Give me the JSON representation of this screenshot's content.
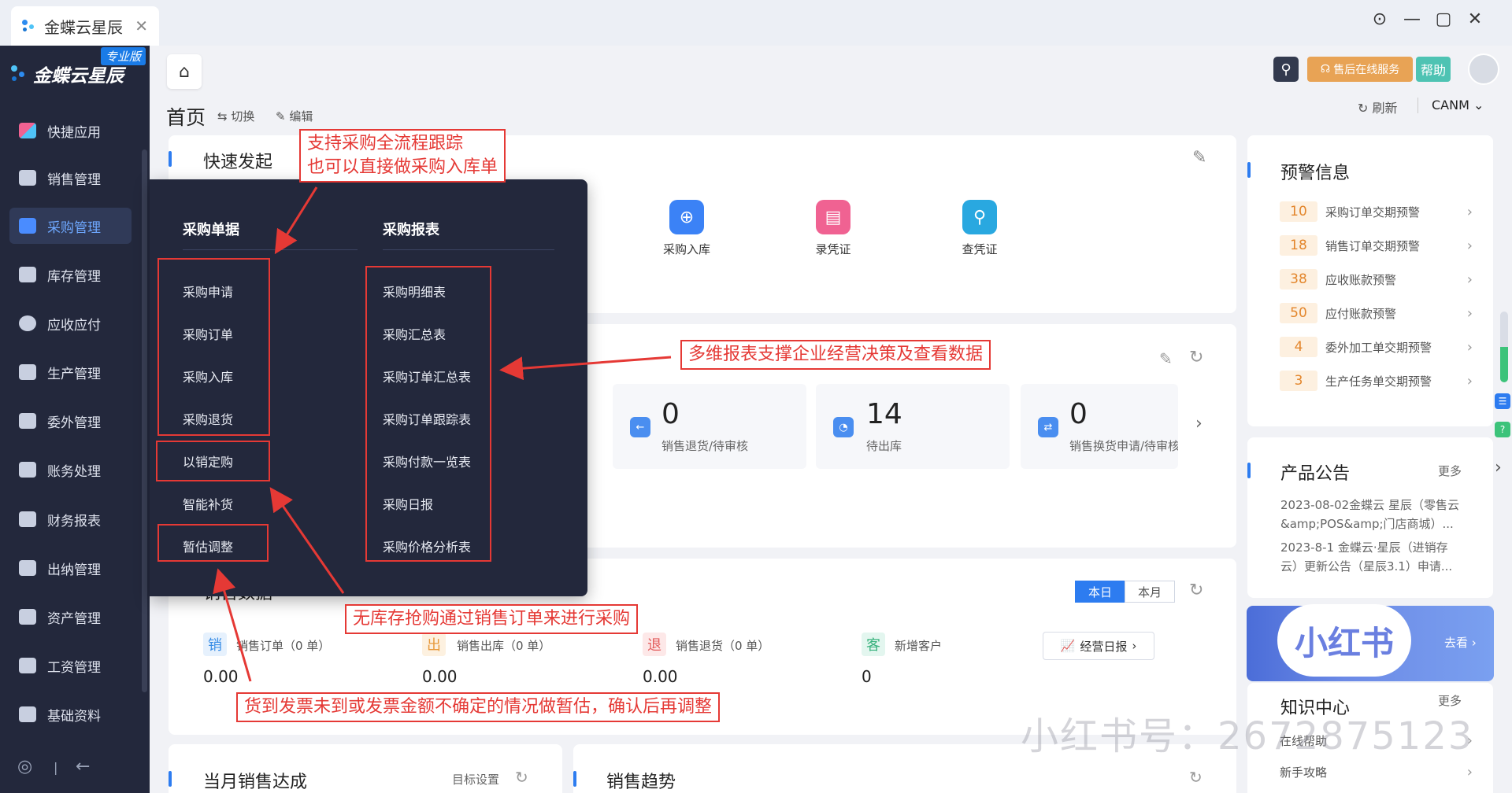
{
  "window": {
    "tab_title": "金蝶云星辰",
    "tab_close": "✕",
    "controls": {
      "more": "⊙",
      "minimize": "—",
      "maximize": "▢",
      "close": "✕"
    }
  },
  "brand": {
    "name": "金蝶云星辰",
    "edition": "专业版"
  },
  "sidebar": {
    "items": [
      {
        "label": "快捷应用",
        "icon": "grid-icon"
      },
      {
        "label": "销售管理",
        "icon": "sales-chart-icon"
      },
      {
        "label": "采购管理",
        "icon": "cart-icon",
        "active": true
      },
      {
        "label": "库存管理",
        "icon": "box-icon"
      },
      {
        "label": "应收应付",
        "icon": "money-icon"
      },
      {
        "label": "生产管理",
        "icon": "factory-icon"
      },
      {
        "label": "委外管理",
        "icon": "outsource-icon"
      },
      {
        "label": "账务处理",
        "icon": "ledger-icon"
      },
      {
        "label": "财务报表",
        "icon": "report-icon"
      },
      {
        "label": "出纳管理",
        "icon": "cashier-icon"
      },
      {
        "label": "资产管理",
        "icon": "asset-icon"
      },
      {
        "label": "工资管理",
        "icon": "salary-icon"
      },
      {
        "label": "基础资料",
        "icon": "layers-icon"
      }
    ]
  },
  "header": {
    "page_title": "首页",
    "switch_label": "切换",
    "edit_label": "编辑",
    "service_label": "售后在线服务",
    "help_label": "帮助",
    "refresh_label": "刷新",
    "company": "CANM"
  },
  "quick_start": {
    "title": "快速发起",
    "items": [
      {
        "label": "采购入库",
        "color": "#3b82f6"
      },
      {
        "label": "录凭证",
        "color": "#f06292"
      },
      {
        "label": "查凭证",
        "color": "#29a8e0"
      }
    ]
  },
  "stats": [
    {
      "value": "0",
      "label": "销售退货/待审核",
      "color": "#4a8ef0"
    },
    {
      "value": "14",
      "label": "待出库",
      "color": "#4a8ef0"
    },
    {
      "value": "0",
      "label": "销售换货申请/待审核",
      "color": "#4a8ef0"
    }
  ],
  "sales_data": {
    "title": "销售数据",
    "today": "本日",
    "month": "本月",
    "daily_report": "经营日报",
    "items": [
      {
        "tag": "销",
        "label": "销售订单（0 单）",
        "value": "0.00",
        "bg": "#e6f1fd",
        "fg": "#3a8ee6"
      },
      {
        "tag": "出",
        "label": "销售出库（0 单）",
        "value": "0.00",
        "bg": "#fdf1e0",
        "fg": "#e89a3c"
      },
      {
        "tag": "退",
        "label": "销售退货（0 单）",
        "value": "0.00",
        "bg": "#fde8e8",
        "fg": "#e35d5d"
      },
      {
        "tag": "客",
        "label": "新增客户",
        "value": "0",
        "bg": "#e3f6ef",
        "fg": "#3bb37f"
      }
    ]
  },
  "monthly": {
    "title": "当月销售达成",
    "target": "目标设置"
  },
  "trend": {
    "title": "销售趋势"
  },
  "warnings": {
    "title": "预警信息",
    "items": [
      {
        "count": "10",
        "label": "采购订单交期预警"
      },
      {
        "count": "18",
        "label": "销售订单交期预警"
      },
      {
        "count": "38",
        "label": "应收账款预警"
      },
      {
        "count": "50",
        "label": "应付账款预警"
      },
      {
        "count": "4",
        "label": "委外加工单交期预警"
      },
      {
        "count": "3",
        "label": "生产任务单交期预警"
      }
    ]
  },
  "notices": {
    "title": "产品公告",
    "more": "更多",
    "items": [
      {
        "line1": "2023-08-02金蝶云 星辰（零售云",
        "line2": "&amp;POS&amp;门店商城）..."
      },
      {
        "line1": "2023-8-1 金蝶云·星辰（进销存",
        "line2": "云）更新公告（星辰3.1）申请..."
      }
    ]
  },
  "banner": {
    "text": "小红书",
    "sub": "去看 ›"
  },
  "knowledge": {
    "title": "知识中心",
    "more": "更多",
    "items": [
      {
        "label": "在线帮助"
      },
      {
        "label": "新手攻略"
      }
    ]
  },
  "purchase_menu": {
    "col1_title": "采购单据",
    "col1": [
      "采购申请",
      "采购订单",
      "采购入库",
      "采购退货",
      "以销定购",
      "智能补货",
      "暂估调整"
    ],
    "col2_title": "采购报表",
    "col2": [
      "采购明细表",
      "采购汇总表",
      "采购订单汇总表",
      "采购订单跟踪表",
      "采购付款一览表",
      "采购日报",
      "采购价格分析表"
    ]
  },
  "annotations": {
    "a1_line1": "支持采购全流程跟踪",
    "a1_line2": "也可以直接做采购入库单",
    "a2": "多维报表支撑企业经营决策及查看数据",
    "a3": "无库存抢购通过销售订单来进行采购",
    "a4": "货到发票未到或发票金额不确定的情况做暂估，确认后再调整"
  },
  "watermark": "小红书号：2672875123"
}
